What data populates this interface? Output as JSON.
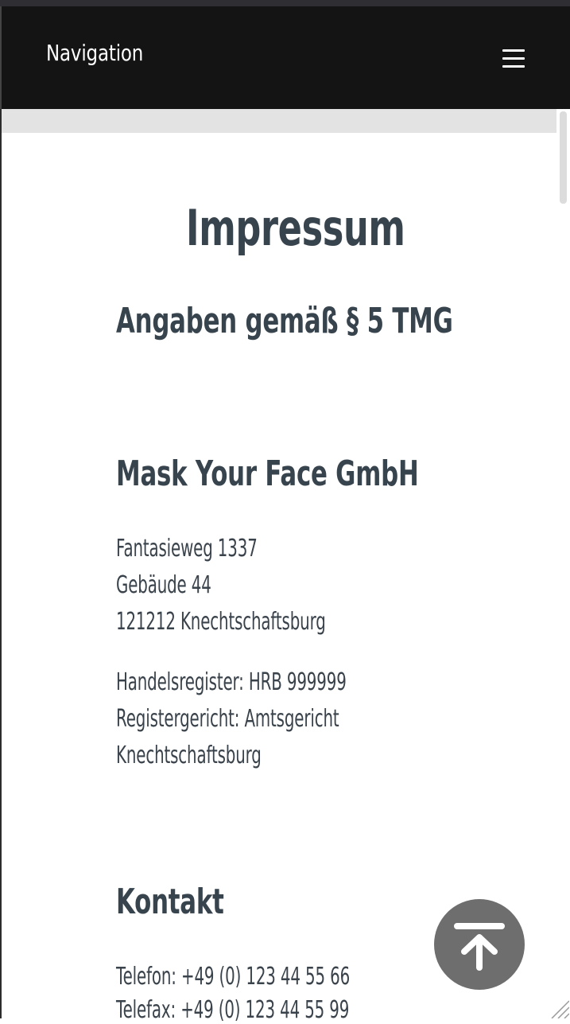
{
  "nav": {
    "title": "Navigation",
    "menu_icon": "hamburger-menu-icon"
  },
  "page": {
    "title": "Impressum",
    "subtitle": "Angaben gemäß § 5 TMG",
    "company": {
      "name": "Mask Your Face GmbH",
      "address": [
        "Fantasieweg 1337",
        "Gebäude 44",
        "121212 Knechtschaftsburg"
      ],
      "register": [
        "Handelsregister: HRB 999999",
        "Registergericht: Amtsgericht",
        "Knechtschaftsburg"
      ]
    },
    "contact": {
      "heading": "Kontakt",
      "phone": "Telefon: +49 (0) 123 44 55 66",
      "fax": "Telefax: +49 (0) 123 44 55 99"
    }
  },
  "back_to_top_icon": "arrow-up-to-top-icon"
}
